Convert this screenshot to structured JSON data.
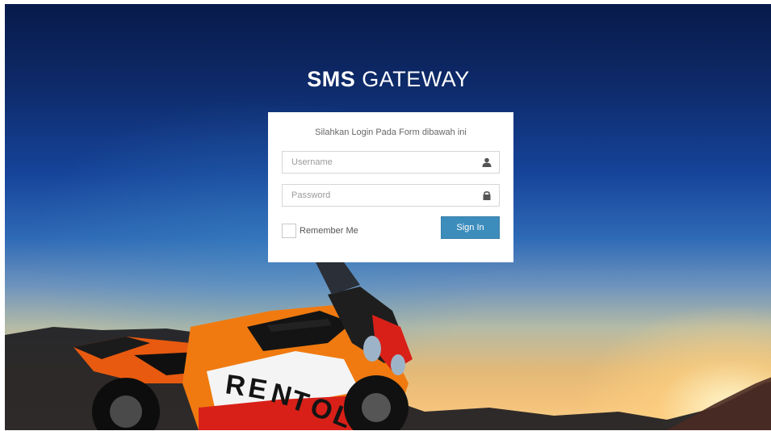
{
  "brand": {
    "bold": "SMS",
    "light": " GATEWAY"
  },
  "login": {
    "message": "Silahkan Login Pada Form dibawah ini",
    "username_placeholder": "Username",
    "password_placeholder": "Password",
    "remember_label": "Remember Me",
    "signin_label": "Sign In",
    "remember_checked": false
  },
  "icons": {
    "username": "user-icon",
    "password": "lock-icon"
  },
  "background": {
    "motorcycle_livery": [
      "R",
      "E",
      "N",
      "T",
      "O",
      "L"
    ],
    "accent_color": "#3c8dbc"
  }
}
